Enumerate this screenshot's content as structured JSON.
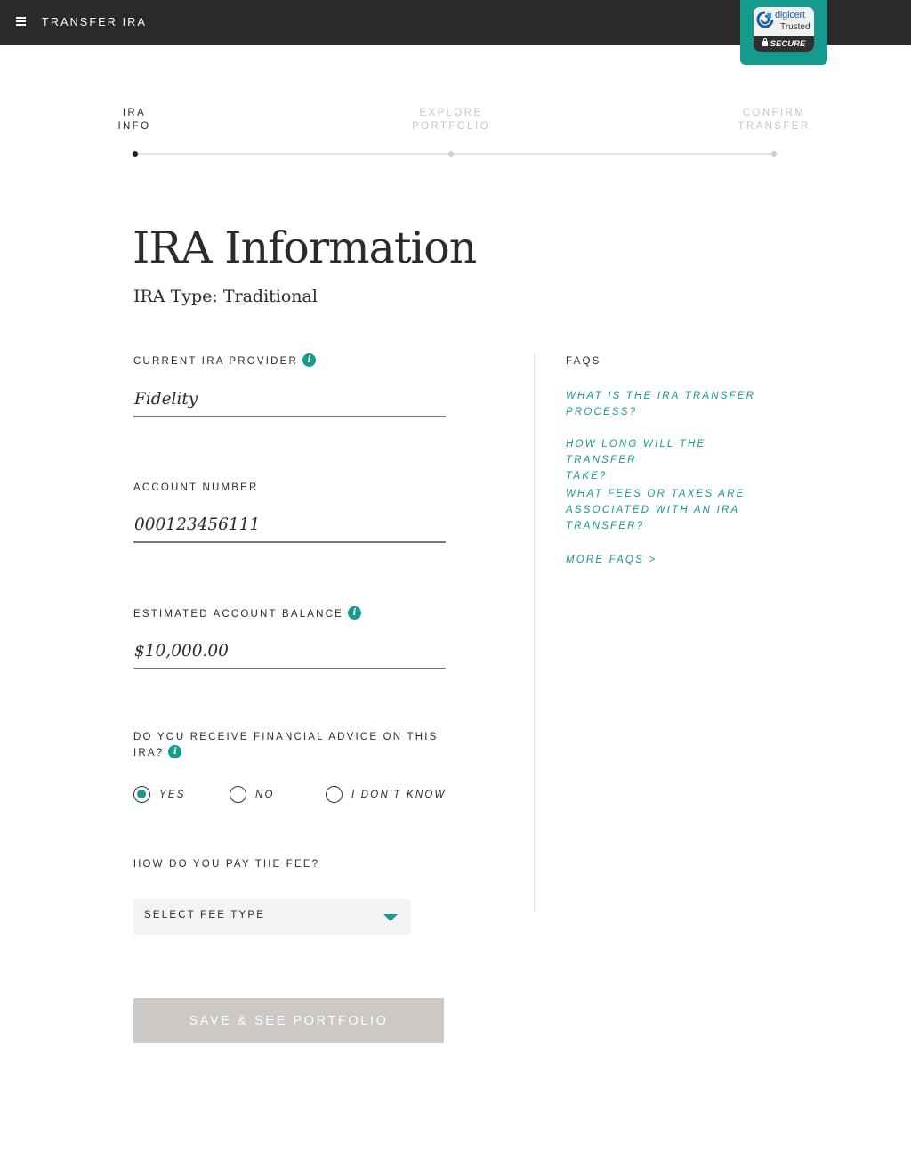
{
  "header": {
    "title": "TRANSFER IRA",
    "badge": {
      "brand": "digicert",
      "trusted": "Trusted",
      "secure": "SECURE"
    }
  },
  "stepper": {
    "steps": [
      {
        "line1": "IRA",
        "line2": "INFO",
        "state": "active"
      },
      {
        "line1": "EXPLORE",
        "line2": "PORTFOLIO",
        "state": "upcoming"
      },
      {
        "line1": "CONFIRM",
        "line2": "TRANSFER",
        "state": "upcoming"
      }
    ]
  },
  "page": {
    "title": "IRA Information",
    "subtitle": "IRA Type: Traditional"
  },
  "form": {
    "provider": {
      "label": "CURRENT IRA PROVIDER",
      "value": "Fidelity"
    },
    "account": {
      "label": "ACCOUNT NUMBER",
      "value": "000123456111"
    },
    "balance": {
      "label": "ESTIMATED ACCOUNT BALANCE",
      "value": "$10,000.00"
    },
    "advice": {
      "label_line1": "DO YOU RECEIVE FINANCIAL ADVICE ON THIS",
      "label_line2": "IRA?",
      "options": [
        "YES",
        "NO",
        "I DON'T KNOW"
      ],
      "selected": "YES"
    },
    "fee": {
      "label": "HOW DO YOU PAY THE FEE?",
      "placeholder": "SELECT FEE TYPE"
    },
    "submit_label": "SAVE & SEE PORTFOLIO"
  },
  "faqs": {
    "title": "FAQS",
    "items": [
      {
        "line1": "WHAT IS THE IRA TRANSFER",
        "line2": "PROCESS?"
      },
      {
        "line1": "HOW LONG WILL THE TRANSFER",
        "line2": "TAKE?"
      },
      {
        "line1": "WHAT FEES OR TAXES ARE",
        "line2": "ASSOCIATED WITH AN IRA",
        "line3": "TRANSFER?"
      }
    ],
    "more": "MORE FAQS >"
  },
  "colors": {
    "accent": "#159b8d",
    "topbar": "#2b2a29",
    "button_disabled": "#cbc8c5"
  }
}
